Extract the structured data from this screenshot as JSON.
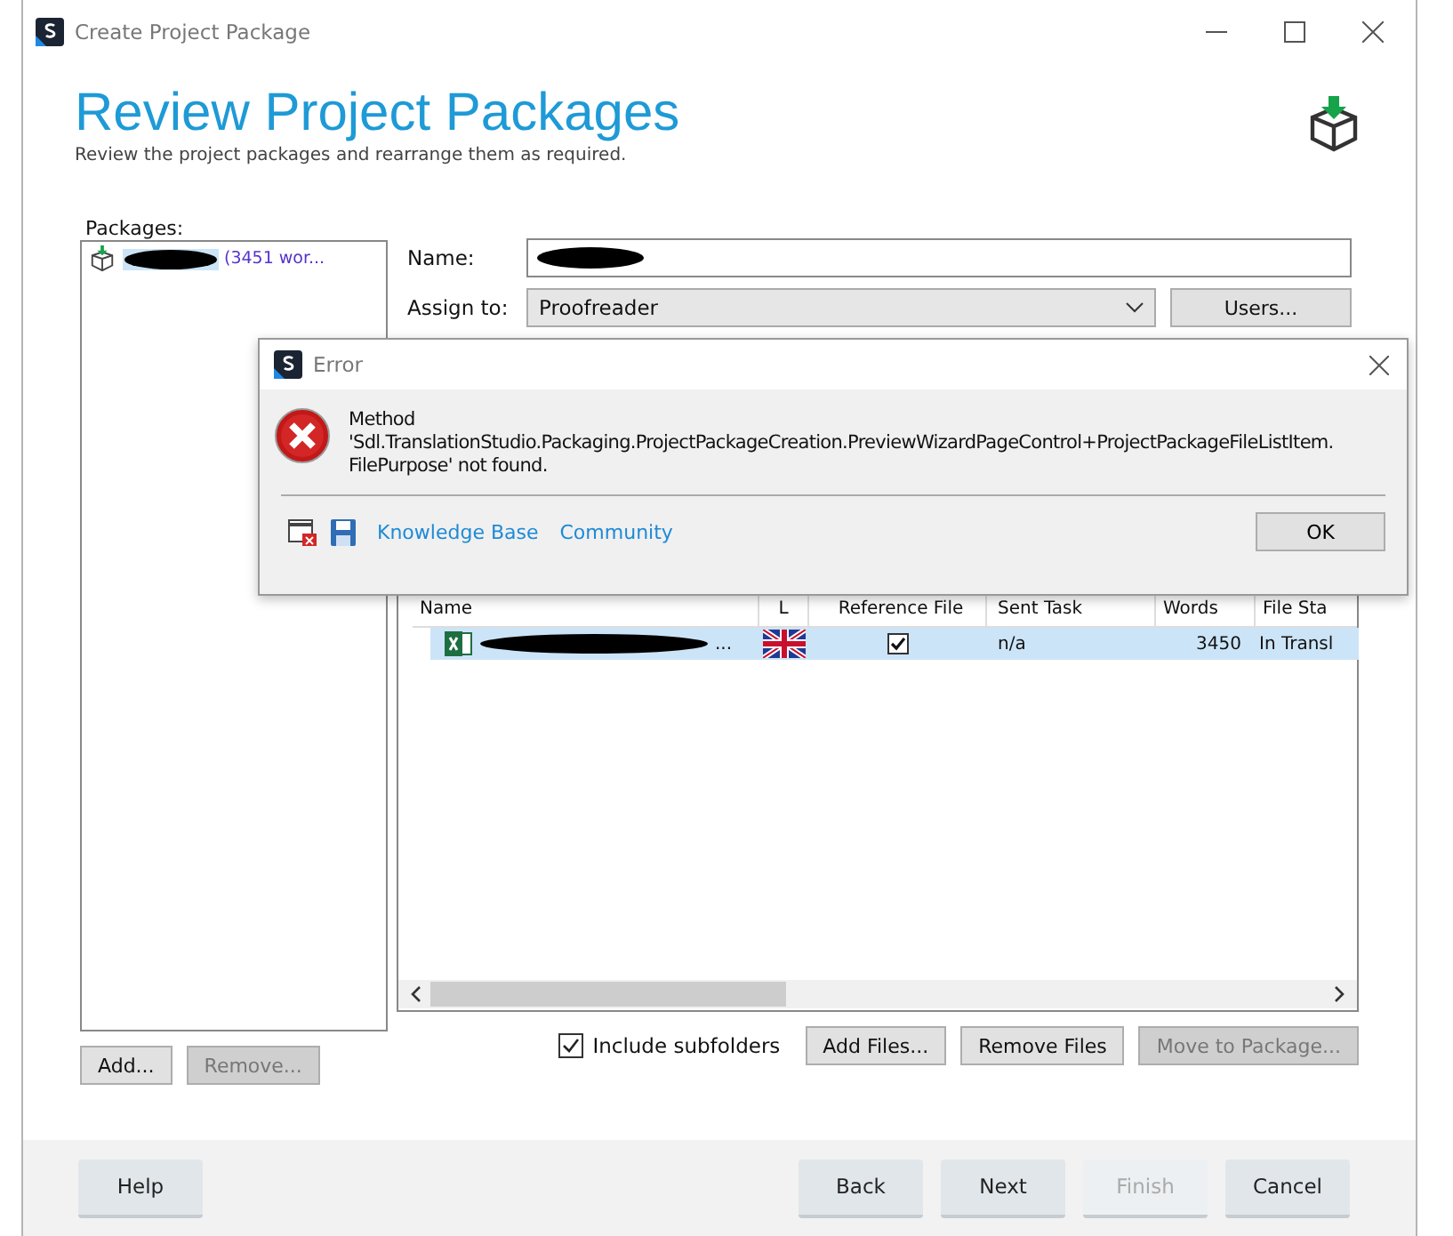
{
  "window": {
    "title": "Create Project Package"
  },
  "header": {
    "title": "Review Project Packages",
    "subtitle": "Review the project packages and  rearrange them as required."
  },
  "packages": {
    "label": "Packages:",
    "items": [
      {
        "words": "(3451 wor...",
        "selected": true
      }
    ]
  },
  "name_field": {
    "label": "Name:"
  },
  "assign": {
    "label": "Assign to:",
    "value": "Proofreader",
    "button": "Users..."
  },
  "files_table": {
    "columns": [
      "Name",
      "L",
      "Reference File",
      "Sent Task",
      "Words",
      "File Sta"
    ],
    "rows": [
      {
        "name_suffix": "...",
        "reference_file": true,
        "sent_task": "n/a",
        "words": "3450",
        "file_status": "In Transl",
        "selected": true
      }
    ]
  },
  "package_buttons": [
    {
      "label": "Add...",
      "disabled": false
    },
    {
      "label": "Remove...",
      "disabled": true
    }
  ],
  "include_subfolders": {
    "label": "Include subfolders",
    "checked": true
  },
  "file_buttons": [
    {
      "label": "Add Files...",
      "disabled": false
    },
    {
      "label": "Remove Files",
      "disabled": false
    },
    {
      "label": "Move to Package...",
      "disabled": true
    }
  ],
  "footer": {
    "help": "Help",
    "nav": [
      {
        "label": "Back",
        "disabled": false
      },
      {
        "label": "Next",
        "disabled": false
      },
      {
        "label": "Finish",
        "disabled": true
      },
      {
        "label": "Cancel",
        "disabled": false
      }
    ]
  },
  "error_dialog": {
    "title": "Error",
    "message": "Method\n'Sdl.TranslationStudio.Packaging.ProjectPackageCreation.PreviewWizardPageControl+ProjectPackageFileListItem.\nFilePurpose' not found.",
    "links": [
      "Knowledge Base",
      "Community"
    ],
    "button": "OK"
  }
}
